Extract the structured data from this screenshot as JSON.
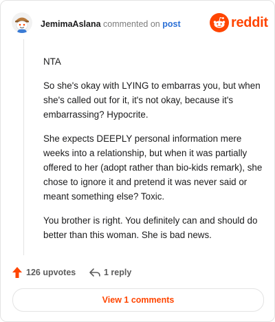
{
  "header": {
    "username": "JemimaAslana",
    "action_text": "commented on",
    "post_link": "post",
    "brand": "reddit"
  },
  "comment": {
    "paragraphs": [
      "NTA",
      "So she's okay with LYING to embarras you, but when she's called out for it, it's not okay, because it's embarrassing? Hypocrite.",
      "She expects DEEPLY personal information mere weeks into a relationship, but when it was partially offered to her (adopt rather than bio-kids remark), she chose to ignore it and pretend it was never said or meant something else? Toxic.",
      "You brother is right. You definitely can and should do better than this woman. She is bad news."
    ]
  },
  "footer": {
    "upvotes": "126 upvotes",
    "replies": "1 reply",
    "view_comments": "View 1 comments"
  },
  "colors": {
    "brand": "#ff4500",
    "link": "#2a6fd6",
    "muted": "#7c7c7c"
  },
  "icons": {
    "avatar": "snoo-avatar",
    "logo": "reddit-logo-icon",
    "upvote": "upvote-arrow-icon",
    "reply": "reply-arrow-icon"
  }
}
